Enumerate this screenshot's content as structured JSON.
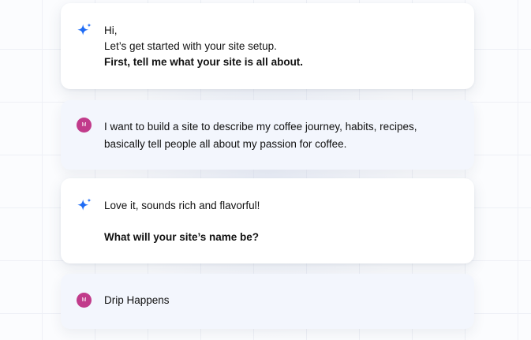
{
  "messages": [
    {
      "sender": "assistant",
      "icon": "sparkle-icon",
      "lines": [
        "Hi,",
        "Let’s get started with your site setup."
      ],
      "bold_line": "First, tell me what your site is all about."
    },
    {
      "sender": "user",
      "avatar_initial": "M",
      "lines": [
        "I want to build a site to describe my coffee journey, habits, recipes,",
        "basically tell people all about my passion for coffee."
      ]
    },
    {
      "sender": "assistant",
      "icon": "sparkle-icon",
      "lines": [
        "Love it, sounds rich and flavorful!"
      ],
      "bold_line": "What will your site’s name be?"
    },
    {
      "sender": "user",
      "avatar_initial": "M",
      "lines": [
        "Drip Happens"
      ]
    }
  ],
  "colors": {
    "sparkle": "#1f6cf5",
    "avatar": "#c13b8b",
    "user_bubble": "#f3f6fd",
    "assistant_bubble": "#ffffff"
  }
}
